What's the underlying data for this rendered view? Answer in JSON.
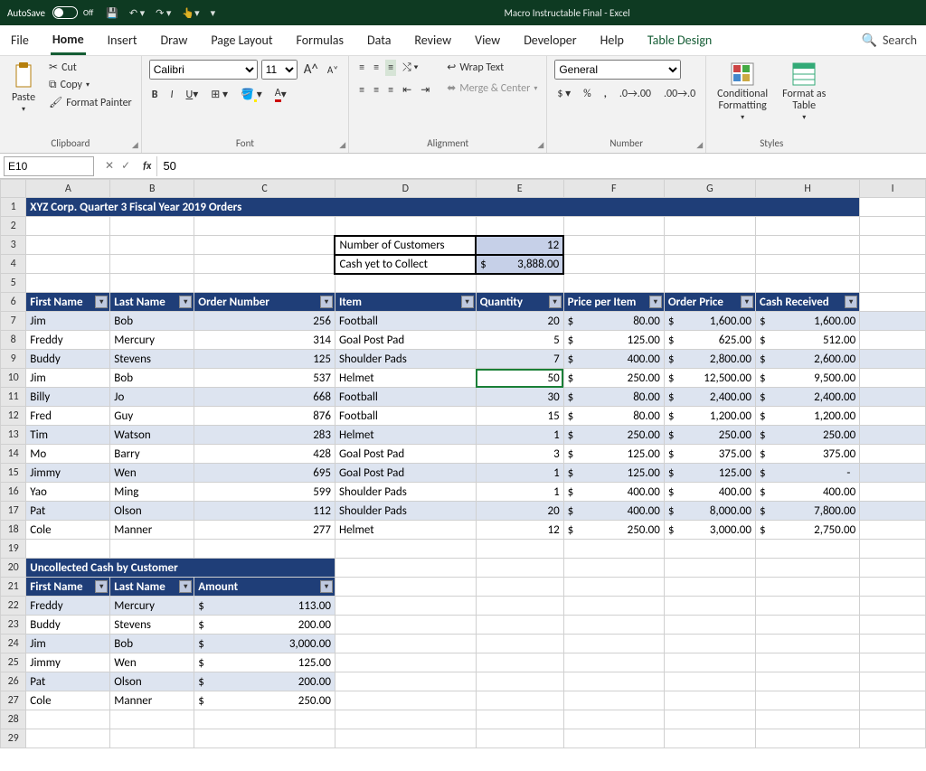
{
  "titlebar": {
    "autosave": "AutoSave",
    "off": "Off",
    "title": "Macro Instructable Final  -  Excel"
  },
  "tabs": {
    "file": "File",
    "home": "Home",
    "insert": "Insert",
    "draw": "Draw",
    "pagelayout": "Page Layout",
    "formulas": "Formulas",
    "data": "Data",
    "review": "Review",
    "view": "View",
    "developer": "Developer",
    "help": "Help",
    "tabledesign": "Table Design",
    "search": "Search"
  },
  "ribbon": {
    "paste": "Paste",
    "cut": "Cut",
    "copy": "Copy",
    "fmtpainter": "Format Painter",
    "clipboard": "Clipboard",
    "fontname": "Calibri",
    "fontsize": "11",
    "font": "Font",
    "wrap": "Wrap Text",
    "merge": "Merge & Center",
    "alignment": "Alignment",
    "numfmt": "General",
    "number": "Number",
    "condfmt": "Conditional\nFormatting",
    "fmttable": "Format as\nTable",
    "styles": "Styles"
  },
  "fbar": {
    "name": "E10",
    "formula": "50"
  },
  "cols": [
    "A",
    "B",
    "C",
    "D",
    "E",
    "F",
    "G",
    "H",
    "I"
  ],
  "title_row": "XYZ Corp. Quarter 3 Fiscal Year 2019 Orders",
  "summary": {
    "l1": "Number of Customers",
    "v1": "12",
    "l2": "Cash yet to Collect",
    "v2_pre": "$",
    "v2": "3,888.00"
  },
  "orders_hdr": [
    "First Name",
    "Last Name",
    "Order Number",
    "Item",
    "Quantity",
    "Price per Item",
    "Order Price",
    "Cash Received"
  ],
  "orders": [
    {
      "fn": "Jim",
      "ln": "Bob",
      "on": "256",
      "it": "Football",
      "qty": "20",
      "ppi": "80.00",
      "op": "1,600.00",
      "cr": "1,600.00"
    },
    {
      "fn": "Freddy",
      "ln": "Mercury",
      "on": "314",
      "it": "Goal Post Pad",
      "qty": "5",
      "ppi": "125.00",
      "op": "625.00",
      "cr": "512.00"
    },
    {
      "fn": "Buddy",
      "ln": "Stevens",
      "on": "125",
      "it": "Shoulder Pads",
      "qty": "7",
      "ppi": "400.00",
      "op": "2,800.00",
      "cr": "2,600.00"
    },
    {
      "fn": "Jim",
      "ln": "Bob",
      "on": "537",
      "it": "Helmet",
      "qty": "50",
      "ppi": "250.00",
      "op": "12,500.00",
      "cr": "9,500.00"
    },
    {
      "fn": "Billy",
      "ln": "Jo",
      "on": "668",
      "it": "Football",
      "qty": "30",
      "ppi": "80.00",
      "op": "2,400.00",
      "cr": "2,400.00"
    },
    {
      "fn": "Fred",
      "ln": "Guy",
      "on": "876",
      "it": "Football",
      "qty": "15",
      "ppi": "80.00",
      "op": "1,200.00",
      "cr": "1,200.00"
    },
    {
      "fn": "Tim",
      "ln": "Watson",
      "on": "283",
      "it": "Helmet",
      "qty": "1",
      "ppi": "250.00",
      "op": "250.00",
      "cr": "250.00"
    },
    {
      "fn": "Mo",
      "ln": "Barry",
      "on": "428",
      "it": "Goal Post Pad",
      "qty": "3",
      "ppi": "125.00",
      "op": "375.00",
      "cr": "375.00"
    },
    {
      "fn": "Jimmy",
      "ln": "Wen",
      "on": "695",
      "it": "Goal Post Pad",
      "qty": "1",
      "ppi": "125.00",
      "op": "125.00",
      "cr": "-"
    },
    {
      "fn": "Yao",
      "ln": "Ming",
      "on": "599",
      "it": "Shoulder Pads",
      "qty": "1",
      "ppi": "400.00",
      "op": "400.00",
      "cr": "400.00"
    },
    {
      "fn": "Pat",
      "ln": "Olson",
      "on": "112",
      "it": "Shoulder Pads",
      "qty": "20",
      "ppi": "400.00",
      "op": "8,000.00",
      "cr": "7,800.00"
    },
    {
      "fn": "Cole",
      "ln": "Manner",
      "on": "277",
      "it": "Helmet",
      "qty": "12",
      "ppi": "250.00",
      "op": "3,000.00",
      "cr": "2,750.00"
    }
  ],
  "uncollected_title": "Uncollected Cash by Customer",
  "uncollected_hdr": [
    "First Name",
    "Last Name",
    "Amount"
  ],
  "uncollected": [
    {
      "fn": "Freddy",
      "ln": "Mercury",
      "amt": "113.00"
    },
    {
      "fn": "Buddy",
      "ln": "Stevens",
      "amt": "200.00"
    },
    {
      "fn": "Jim",
      "ln": "Bob",
      "amt": "3,000.00"
    },
    {
      "fn": "Jimmy",
      "ln": "Wen",
      "amt": "125.00"
    },
    {
      "fn": "Pat",
      "ln": "Olson",
      "amt": "200.00"
    },
    {
      "fn": "Cole",
      "ln": "Manner",
      "amt": "250.00"
    }
  ]
}
